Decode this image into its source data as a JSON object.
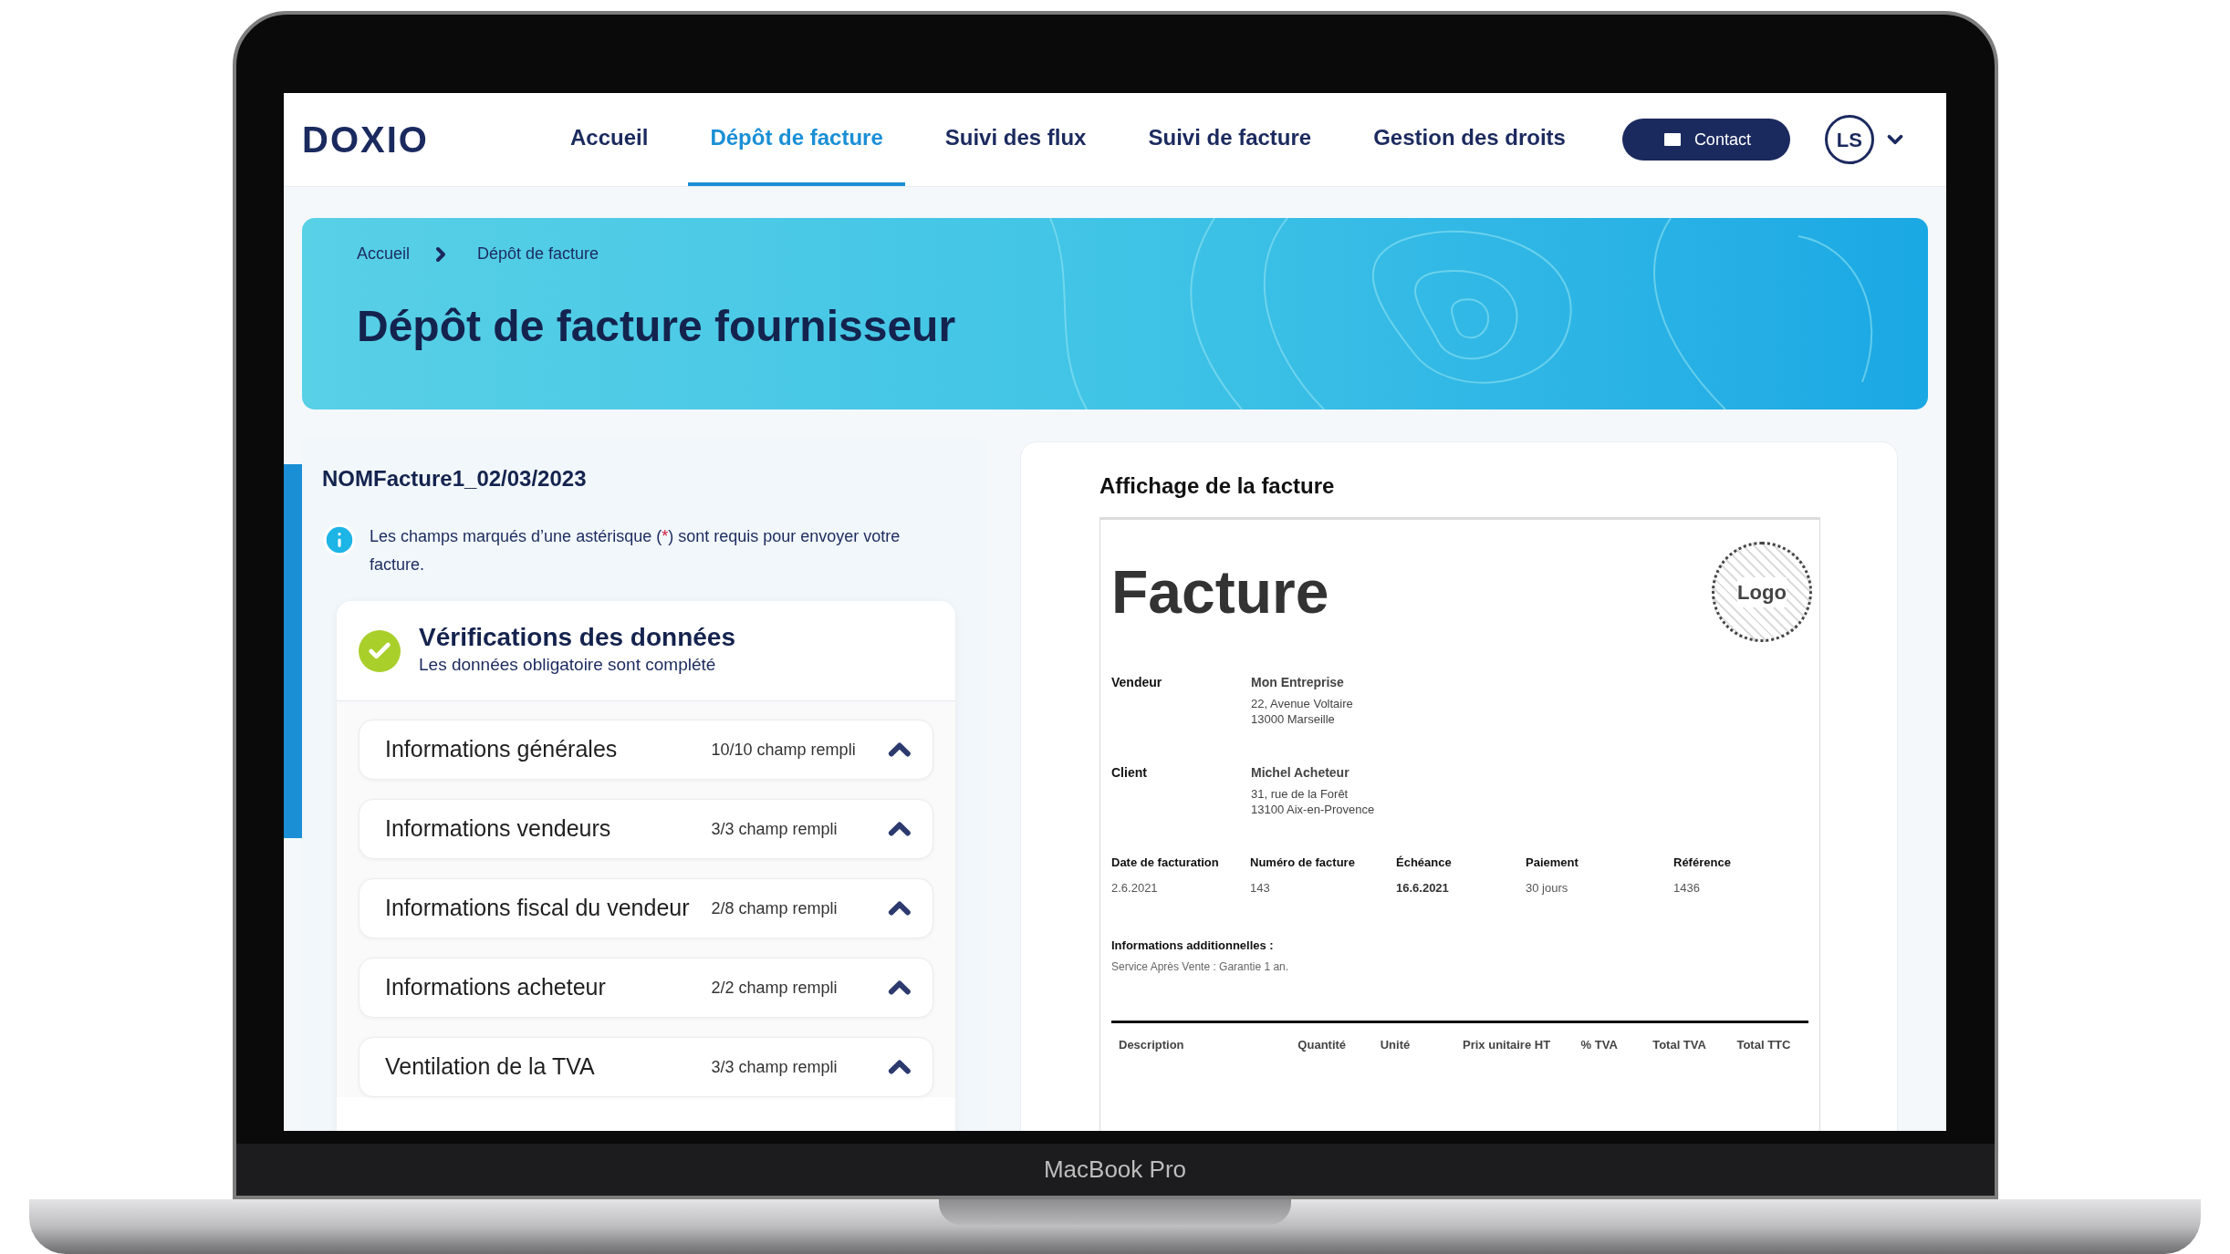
{
  "device": {
    "label": "MacBook Pro"
  },
  "header": {
    "logo": "DOXIO",
    "nav": [
      {
        "label": "Accueil",
        "selected": false
      },
      {
        "label": "Dépôt de facture",
        "selected": true
      },
      {
        "label": "Suivi des flux",
        "selected": false
      },
      {
        "label": "Suivi de facture",
        "selected": false
      },
      {
        "label": "Gestion des droits",
        "selected": false
      }
    ],
    "contact_button": "Contact",
    "avatar": "LS"
  },
  "banner": {
    "breadcrumb": [
      "Accueil",
      "Dépôt de facture"
    ],
    "title": "Dépôt de facture fournisseur"
  },
  "form_panel": {
    "file_name": "NOMFacture1_02/03/2023",
    "notice": {
      "before": "Les champs marqués d’une astérisque (",
      "mark": "*",
      "after": ") sont requis pour envoyer votre facture."
    },
    "verification": {
      "title": "Vérifications des données",
      "subtitle": "Les données obligatoire sont complété",
      "passed": true
    },
    "sections": [
      {
        "label": "Informations générales",
        "count": "10/10 champ rempli",
        "expanded": true
      },
      {
        "label": "Informations vendeurs",
        "count": "3/3 champ rempli",
        "expanded": true
      },
      {
        "label": "Informations fiscal du vendeur",
        "count": "2/8 champ rempli",
        "expanded": true
      },
      {
        "label": "Informations acheteur",
        "count": "2/2 champ rempli",
        "expanded": true
      },
      {
        "label": "Ventilation de la TVA",
        "count": "3/3 champ rempli",
        "expanded": true
      }
    ]
  },
  "invoice_preview": {
    "title": "Affichage de la facture",
    "document": {
      "heading": "Facture",
      "logo": "Logo",
      "parties": [
        {
          "label": "Vendeur",
          "name": "Mon Entreprise",
          "address": [
            "22, Avenue Voltaire",
            "13000 Marseille"
          ]
        },
        {
          "label": "Client",
          "name": "Michel Acheteur",
          "address": [
            "31, rue de la Forêt",
            "13100 Aix-en-Provence"
          ]
        }
      ],
      "details": [
        {
          "label": "Date de facturation",
          "value": "2.6.2021",
          "emphasized": false
        },
        {
          "label": "Numéro de facture",
          "value": "143",
          "emphasized": false
        },
        {
          "label": "Échéance",
          "value": "16.6.2021",
          "emphasized": true
        },
        {
          "label": "Paiement",
          "value": "30 jours",
          "emphasized": false
        },
        {
          "label": "Référence",
          "value": "1436",
          "emphasized": false
        }
      ],
      "additional": {
        "label": "Informations additionnelles :",
        "text": "Service Après Vente : Garantie 1 an."
      },
      "table_columns": [
        "Description",
        "Quantité",
        "Unité",
        "Prix unitaire HT",
        "% TVA",
        "Total TVA",
        "Total TTC"
      ]
    }
  }
}
